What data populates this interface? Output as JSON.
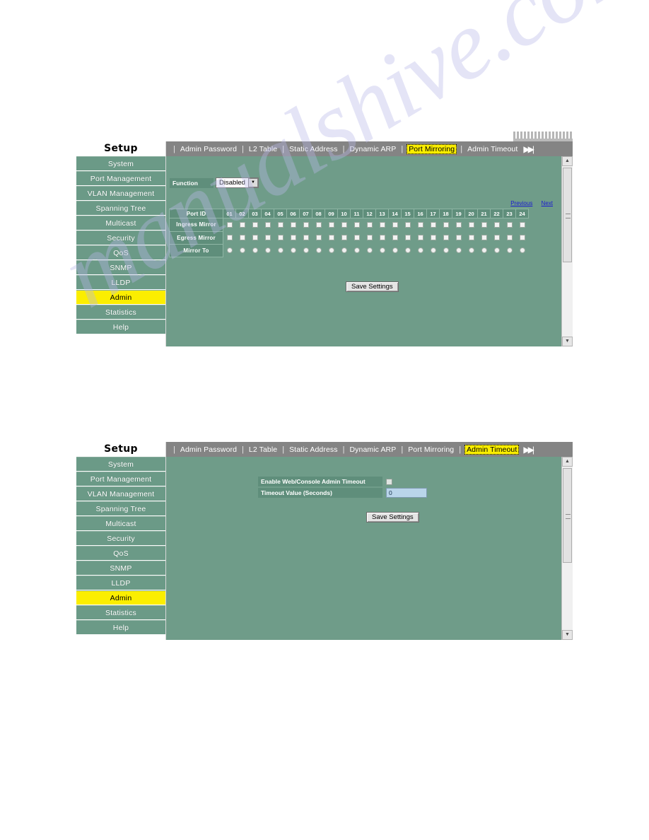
{
  "watermark": {
    "text": "manualshive.com"
  },
  "common": {
    "sidebar_title": "Setup",
    "sidebar_items": [
      "System",
      "Port Management",
      "VLAN Management",
      "Spanning Tree",
      "Multicast",
      "Security",
      "QoS",
      "SNMP",
      "LLDP",
      "Admin",
      "Statistics",
      "Help"
    ],
    "active_sidebar_item": "Admin",
    "tabs": [
      "Admin Password",
      "L2 Table",
      "Static Address",
      "Dynamic ARP",
      "Port Mirroring",
      "Admin Timeout"
    ],
    "tab_next_icon": "next-page-icon",
    "save_label": "Save Settings",
    "colors": {
      "panel_bg": "#6f9c89",
      "sidebar_item_bg": "#6b9a87",
      "tabbar_bg": "#848484",
      "highlight": "#fbee00",
      "label_bg": "#5f8e7b",
      "link": "#1a1ad0",
      "input_bg": "#b9d5ea"
    }
  },
  "shot_top": {
    "active_tab": "Port Mirroring",
    "function": {
      "label": "Function",
      "value": "Disabled"
    },
    "pager": {
      "previous": "Previous",
      "next": "Next"
    },
    "table": {
      "row_labels": [
        "Port ID",
        "Ingress Mirror",
        "Egress Mirror",
        "Mirror To"
      ],
      "port_ids": [
        "01",
        "02",
        "03",
        "04",
        "05",
        "06",
        "07",
        "08",
        "09",
        "10",
        "11",
        "12",
        "13",
        "14",
        "15",
        "16",
        "17",
        "18",
        "19",
        "20",
        "21",
        "22",
        "23",
        "24"
      ],
      "ingress_mirror": [
        false,
        false,
        false,
        false,
        false,
        false,
        false,
        false,
        false,
        false,
        false,
        false,
        false,
        false,
        false,
        false,
        false,
        false,
        false,
        false,
        false,
        false,
        false,
        false
      ],
      "egress_mirror": [
        false,
        false,
        false,
        false,
        false,
        false,
        false,
        false,
        false,
        false,
        false,
        false,
        false,
        false,
        false,
        false,
        false,
        false,
        false,
        false,
        false,
        false,
        false,
        false
      ],
      "mirror_to": [
        false,
        false,
        false,
        false,
        false,
        false,
        false,
        false,
        false,
        false,
        false,
        false,
        false,
        false,
        false,
        false,
        false,
        false,
        false,
        false,
        false,
        false,
        false,
        false
      ]
    }
  },
  "shot_bottom": {
    "active_tab": "Admin Timeout",
    "form": {
      "enable_label": "Enable Web/Console Admin Timeout",
      "enable_checked": false,
      "timeout_label": "Timeout Value (Seconds)",
      "timeout_value": "0"
    }
  }
}
